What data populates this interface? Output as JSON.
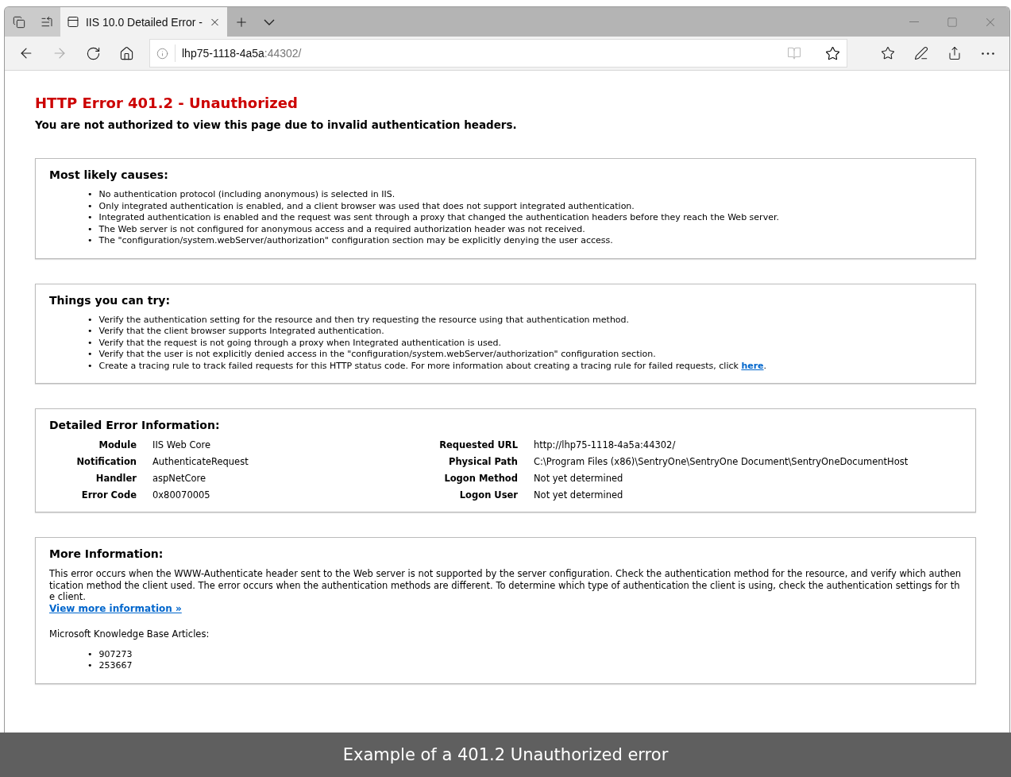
{
  "browser": {
    "tab": {
      "title": "IIS 10.0 Detailed Error -",
      "selected": true
    },
    "address": {
      "host": "lhp75-1118-4a5a",
      "port": ":44302/"
    }
  },
  "page": {
    "title": "HTTP Error 401.2 - Unauthorized",
    "subtitle": "You are not authorized to view this page due to invalid authentication headers.",
    "sections": [
      {
        "kind": "list",
        "heading": "Most likely causes:",
        "bullet": "•",
        "items": [
          {
            "text": "No authentication protocol (including anonymous) is selected in IIS."
          },
          {
            "text": "Only integrated authentication is enabled, and a client browser was used that does not support integrated authentication."
          },
          {
            "text": "Integrated authentication is enabled and the request was sent through a proxy that changed the authentication headers before they reach the Web server."
          },
          {
            "text": "The Web server is not configured for anonymous access and a required authorization header was not received."
          },
          {
            "text": "The \"configuration/system.webServer/authorization\" configuration section may be explicitly denying the user access."
          }
        ]
      },
      {
        "kind": "list",
        "heading": "Things you can try:",
        "bullet": "•",
        "items": [
          {
            "text": "Verify the authentication setting for the resource and then try requesting the resource using that authentication method."
          },
          {
            "text": "Verify that the client browser supports Integrated authentication."
          },
          {
            "text": "Verify that the request is not going through a proxy when Integrated authentication is used."
          },
          {
            "text": "Verify that the user is not explicitly denied access in the \"configuration/system.webServer/authorization\" configuration section."
          },
          {
            "text": "Create a tracing rule to track failed requests for this HTTP status code. For more information about creating a tracing rule for failed requests, click",
            "link": "here",
            "after": "."
          }
        ]
      },
      {
        "kind": "details",
        "heading": "Detailed Error Information:",
        "left": [
          {
            "label": "Module",
            "value": "IIS Web Core"
          },
          {
            "label": "Notification",
            "value": "AuthenticateRequest"
          },
          {
            "label": "Handler",
            "value": "aspNetCore"
          },
          {
            "label": "Error Code",
            "value": "0x80070005"
          }
        ],
        "right": [
          {
            "label": "Requested URL",
            "value": "http://lhp75-1118-4a5a:44302/"
          },
          {
            "label": "Physical Path",
            "value": "C:\\Program Files (x86)\\SentryOne\\SentryOne Document\\SentryOneDocumentHost"
          },
          {
            "label": "Logon Method",
            "value": "Not yet determined"
          },
          {
            "label": "Logon User",
            "value": "Not yet determined"
          }
        ]
      },
      {
        "kind": "more",
        "heading": "More Information:",
        "paragraph": "This error occurs when the WWW-Authenticate header sent to the Web server is not supported by the server configuration. Check the authentication method for the resource, and verify which authentication method the client used. The error occurs when the authentication methods are different. To determine which type of authentication the client is using, check the authentication settings for the client.",
        "link": "View more information »",
        "kb_label": "Microsoft Knowledge Base Articles:",
        "bullet": "•",
        "kb_items": [
          "907273",
          "253667"
        ]
      }
    ]
  },
  "caption": "Example of a 401.2 Unauthorized error"
}
